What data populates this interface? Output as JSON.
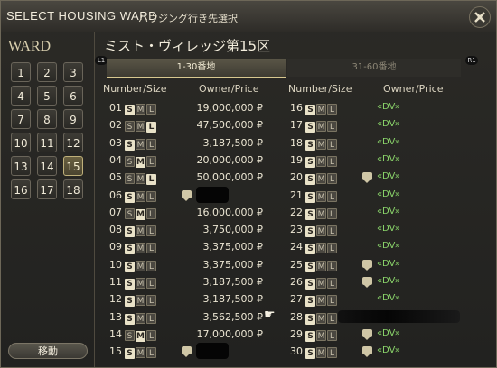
{
  "title_en": "SELECT HOUSING WARD",
  "title_jp": "ハウジング行き先選択",
  "ward_label": "WARD",
  "wards": [
    "1",
    "2",
    "3",
    "4",
    "5",
    "6",
    "7",
    "8",
    "9",
    "10",
    "11",
    "12",
    "13",
    "14",
    "15",
    "16",
    "17",
    "18"
  ],
  "selected_ward": "15",
  "move_button": "移動",
  "district": "ミスト・ヴィレッジ第15区",
  "tabs": [
    "1-30番地",
    "31-60番地"
  ],
  "nav": {
    "left": "L1",
    "right": "R1"
  },
  "headers": {
    "number_size": "Number/Size",
    "owner_price": "Owner/Price"
  },
  "size_letters": [
    "S",
    "M",
    "L"
  ],
  "left_plots": [
    {
      "num": "01",
      "size": "S",
      "price": "19,000,000 ₽"
    },
    {
      "num": "02",
      "size": "L",
      "price": "47,500,000 ₽"
    },
    {
      "num": "03",
      "size": "S",
      "price": "3,187,500 ₽"
    },
    {
      "num": "04",
      "size": "M",
      "price": "20,000,000 ₽"
    },
    {
      "num": "05",
      "size": "L",
      "price": "50,000,000 ₽"
    },
    {
      "num": "06",
      "size": "S",
      "price": ""
    },
    {
      "num": "07",
      "size": "M",
      "price": "16,000,000 ₽"
    },
    {
      "num": "08",
      "size": "S",
      "price": "3,750,000 ₽"
    },
    {
      "num": "09",
      "size": "S",
      "price": "3,375,000 ₽"
    },
    {
      "num": "10",
      "size": "S",
      "price": "3,375,000 ₽"
    },
    {
      "num": "11",
      "size": "S",
      "price": "3,187,500 ₽"
    },
    {
      "num": "12",
      "size": "S",
      "price": "3,187,500 ₽"
    },
    {
      "num": "13",
      "size": "S",
      "price": "3,562,500 ₽"
    },
    {
      "num": "14",
      "size": "M",
      "price": "17,000,000 ₽"
    },
    {
      "num": "15",
      "size": "S",
      "price": ""
    }
  ],
  "right_plots": [
    {
      "num": "16",
      "size": "S",
      "owner": "«DV»"
    },
    {
      "num": "17",
      "size": "S",
      "owner": "«DV»"
    },
    {
      "num": "18",
      "size": "S",
      "owner": "«DV»"
    },
    {
      "num": "19",
      "size": "S",
      "owner": "«DV»"
    },
    {
      "num": "20",
      "size": "S",
      "owner": "«DV»"
    },
    {
      "num": "21",
      "size": "S",
      "owner": "«DV»"
    },
    {
      "num": "22",
      "size": "S",
      "owner": "«DV»"
    },
    {
      "num": "23",
      "size": "S",
      "owner": "«DV»"
    },
    {
      "num": "24",
      "size": "S",
      "owner": "«DV»"
    },
    {
      "num": "25",
      "size": "S",
      "owner": "«DV»"
    },
    {
      "num": "26",
      "size": "S",
      "owner": "«DV»"
    },
    {
      "num": "27",
      "size": "S",
      "owner": "«DV»"
    },
    {
      "num": "28",
      "size": "S",
      "owner": ""
    },
    {
      "num": "29",
      "size": "S",
      "owner": "«DV»"
    },
    {
      "num": "30",
      "size": "S",
      "owner": "«DV»"
    }
  ]
}
